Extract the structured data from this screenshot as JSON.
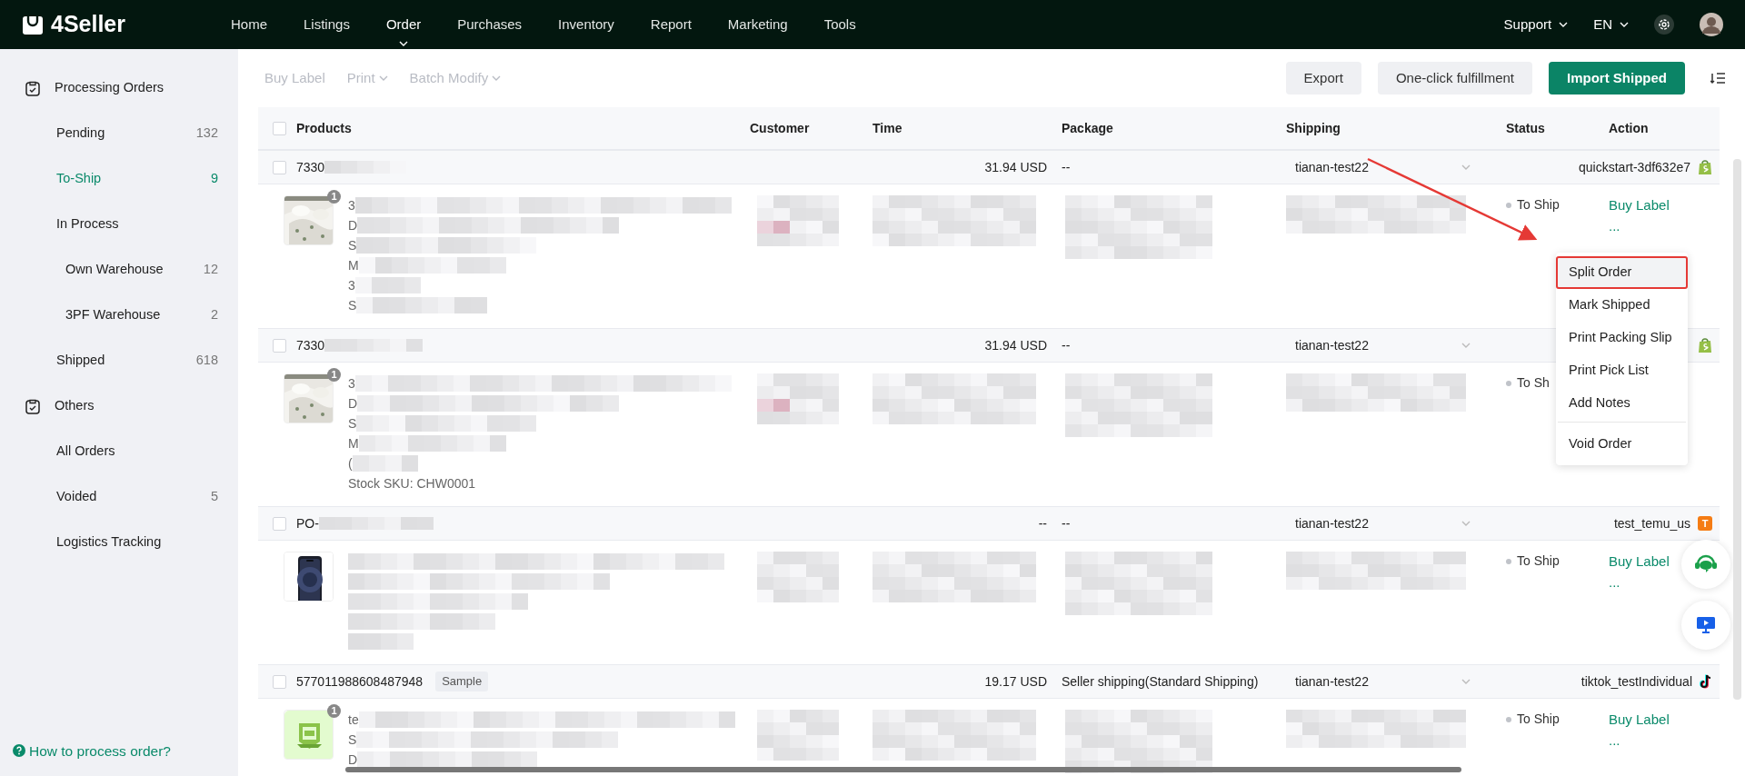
{
  "nav": {
    "logo": "4Seller",
    "menu": [
      {
        "label": "Home",
        "selected": false
      },
      {
        "label": "Listings",
        "selected": false
      },
      {
        "label": "Order",
        "selected": true
      },
      {
        "label": "Purchases",
        "selected": false
      },
      {
        "label": "Inventory",
        "selected": false
      },
      {
        "label": "Report",
        "selected": false
      },
      {
        "label": "Marketing",
        "selected": false
      },
      {
        "label": "Tools",
        "selected": false
      }
    ],
    "support": "Support",
    "language": "EN"
  },
  "sidebar": {
    "groups": [
      {
        "title": "Processing Orders",
        "items": [
          {
            "label": "Pending",
            "count": "132",
            "selected": false
          },
          {
            "label": "To-Ship",
            "count": "9",
            "selected": true
          },
          {
            "label": "In Process",
            "selected": false,
            "children": [
              {
                "label": "Own Warehouse",
                "count": "12",
                "selected": false
              },
              {
                "label": "3PF Warehouse",
                "count": "2",
                "selected": false
              }
            ]
          },
          {
            "label": "Shipped",
            "count": "618",
            "selected": false
          }
        ]
      },
      {
        "title": "Others",
        "items": [
          {
            "label": "All Orders",
            "selected": false
          },
          {
            "label": "Voided",
            "count": "5",
            "selected": false
          },
          {
            "label": "Logistics Tracking",
            "selected": false
          }
        ]
      }
    ],
    "help": "How to process order?"
  },
  "toolbar": {
    "actions": [
      {
        "label": "Buy Label",
        "dropdown": false,
        "disabled": true
      },
      {
        "label": "Print",
        "dropdown": true,
        "disabled": true
      },
      {
        "label": "Batch Modify",
        "dropdown": true,
        "disabled": true
      }
    ],
    "buttons": [
      {
        "label": "Export",
        "kind": "secondary"
      },
      {
        "label": "One-click fulfillment",
        "kind": "secondary"
      },
      {
        "label": "Import Shipped",
        "kind": "primary"
      }
    ]
  },
  "table": {
    "columns": [
      "Products",
      "Customer",
      "Time",
      "Package",
      "Shipping",
      "Status",
      "Action"
    ],
    "all_checked": false,
    "orders": [
      {
        "checked": false,
        "number": "7330",
        "redacted": true,
        "amount": "31.94 USD",
        "package": "--",
        "shipping": "tianan-test22",
        "store": "quickstart-3df632e7",
        "store_logo": {
          "kind": "shopify"
        },
        "thumbnail": {
          "kind": "bedding"
        },
        "quantity": "1",
        "lines": [
          {
            "text": "3",
            "redacted": true
          },
          {
            "text": "D",
            "redacted": true
          },
          {
            "text": "S",
            "redacted": true
          },
          {
            "text": "M",
            "redacted": true
          },
          {
            "text": "3",
            "redacted": true
          },
          {
            "text": "S",
            "redacted": true
          }
        ],
        "status": "To Ship",
        "actions": [
          "Buy Label",
          "..."
        ]
      },
      {
        "checked": false,
        "number": "7330",
        "redacted": true,
        "amount": "31.94 USD",
        "package": "--",
        "shipping": "tianan-test22",
        "store_logo": {
          "kind": "shopify"
        },
        "thumbnail": {
          "kind": "bedding"
        },
        "quantity": "1",
        "lines": [
          {
            "text": "3",
            "redacted": true
          },
          {
            "text": "D",
            "redacted": true
          },
          {
            "text": "S",
            "redacted": true
          },
          {
            "text": "M",
            "redacted": true
          },
          {
            "text": "(",
            "redacted": true
          },
          {
            "text": "Stock SKU: CHW0001",
            "redacted": false
          }
        ],
        "status": "To Sh"
      },
      {
        "checked": false,
        "number": "PO-",
        "redacted": true,
        "amount": "--",
        "package": "--",
        "shipping": "tianan-test22",
        "store": "test_temu_us",
        "store_logo": {
          "kind": "temu",
          "mark": "T"
        },
        "thumbnail": {
          "kind": "phone"
        },
        "lines": [
          {
            "redacted": true
          },
          {
            "redacted": true
          },
          {
            "redacted": true
          },
          {
            "redacted": true
          },
          {
            "redacted": true
          }
        ],
        "status": "To Ship",
        "actions": [
          "Buy Label",
          "..."
        ]
      },
      {
        "checked": false,
        "number": "577011988608487948",
        "redacted": false,
        "tag": "Sample",
        "amount": "19.17 USD",
        "package": "Seller shipping(Standard Shipping)",
        "shipping": "tianan-test22",
        "store": "tiktok_testIndividual",
        "store_logo": {
          "kind": "tiktok"
        },
        "thumbnail": {
          "kind": "badge"
        },
        "quantity": "1",
        "lines": [
          {
            "text": "te",
            "redacted": true
          },
          {
            "text": "S",
            "redacted": true
          },
          {
            "text": "D",
            "redacted": true
          }
        ],
        "status": "To Ship",
        "actions": [
          "Buy Label",
          "..."
        ]
      }
    ]
  },
  "menu": {
    "items": [
      {
        "label": "Split Order",
        "highlighted": true,
        "annotated": true
      },
      {
        "label": "Mark Shipped",
        "highlighted": false,
        "annotated": false
      },
      {
        "label": "Print Packing Slip",
        "highlighted": false,
        "annotated": false
      },
      {
        "label": "Print Pick List",
        "highlighted": false,
        "annotated": false
      },
      {
        "label": "Add Notes",
        "highlighted": false,
        "annotated": false
      },
      {
        "label": "Void Order",
        "highlighted": false,
        "annotated": false,
        "separated": true
      }
    ]
  }
}
